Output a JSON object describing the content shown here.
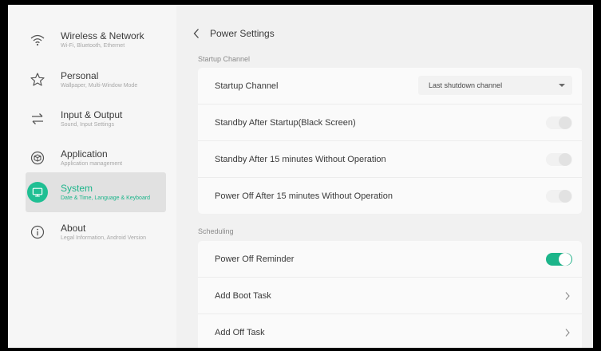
{
  "sidebar": {
    "items": [
      {
        "title": "Wireless & Network",
        "subtitle": "Wi-Fi, Bluetooth, Ethernet",
        "icon": "wifi-icon",
        "active": false
      },
      {
        "title": "Personal",
        "subtitle": "Wallpaper, Multi-Window Mode",
        "icon": "star-icon",
        "active": false
      },
      {
        "title": "Input & Output",
        "subtitle": "Sound, Input Settings",
        "icon": "swap-arrows-icon",
        "active": false
      },
      {
        "title": "Application",
        "subtitle": "Application management",
        "icon": "cube-icon",
        "active": false
      },
      {
        "title": "System",
        "subtitle": "Date & Time, Language & Keyboard",
        "icon": "monitor-icon",
        "active": true
      },
      {
        "title": "About",
        "subtitle": "Legal Information, Android Version",
        "icon": "info-icon",
        "active": false
      }
    ]
  },
  "header": {
    "title": "Power Settings",
    "back_icon": "chevron-left-icon"
  },
  "startup_section": {
    "label": "Startup Channel",
    "startup_channel": {
      "label": "Startup Channel",
      "value": "Last shutdown channel"
    },
    "standby_after_startup": {
      "label": "Standby After Startup(Black Screen)",
      "enabled": false
    },
    "standby_15": {
      "label": "Standby After 15 minutes Without Operation",
      "enabled": false
    },
    "power_off_15": {
      "label": "Power Off After 15 minutes Without Operation",
      "enabled": false
    }
  },
  "scheduling_section": {
    "label": "Scheduling",
    "power_off_reminder": {
      "label": "Power Off Reminder",
      "enabled": true
    },
    "add_boot_task": {
      "label": "Add Boot Task"
    },
    "add_off_task": {
      "label": "Add Off Task"
    }
  },
  "colors": {
    "accent": "#1cb58a",
    "background": "#f1f1f1",
    "card": "#fafafa"
  }
}
